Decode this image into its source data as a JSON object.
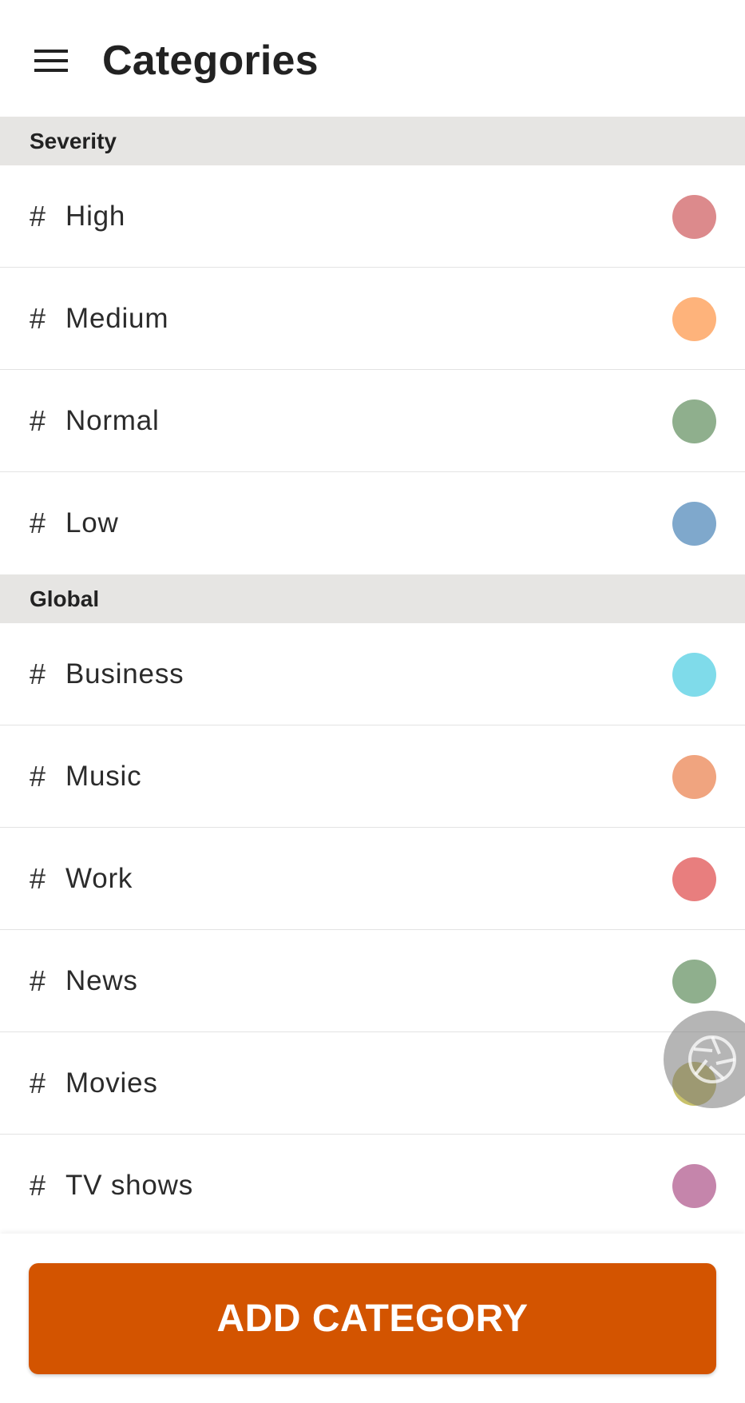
{
  "appbar": {
    "title": "Categories",
    "menu_icon": "hamburger-menu-icon"
  },
  "sections": [
    {
      "header": "Severity",
      "items": [
        {
          "label": "High",
          "color": "#dc8a8c"
        },
        {
          "label": "Medium",
          "color": "#feb37b"
        },
        {
          "label": "Normal",
          "color": "#8faf8d"
        },
        {
          "label": "Low",
          "color": "#7fa8cc"
        }
      ]
    },
    {
      "header": "Global",
      "items": [
        {
          "label": "Business",
          "color": "#7fdbea"
        },
        {
          "label": "Music",
          "color": "#f0a47f"
        },
        {
          "label": "Work",
          "color": "#e87e7e"
        },
        {
          "label": "News",
          "color": "#8faf8d"
        },
        {
          "label": "Movies",
          "color": "#c9c26b"
        },
        {
          "label": "TV shows",
          "color": "#c585ab"
        }
      ]
    }
  ],
  "hash_symbol": "#",
  "floating_button": {
    "icon": "camera-aperture-icon"
  },
  "bottom": {
    "add_button_label": "ADD CATEGORY"
  },
  "colors": {
    "accent": "#d35400",
    "section_bg": "#e6e5e3"
  }
}
